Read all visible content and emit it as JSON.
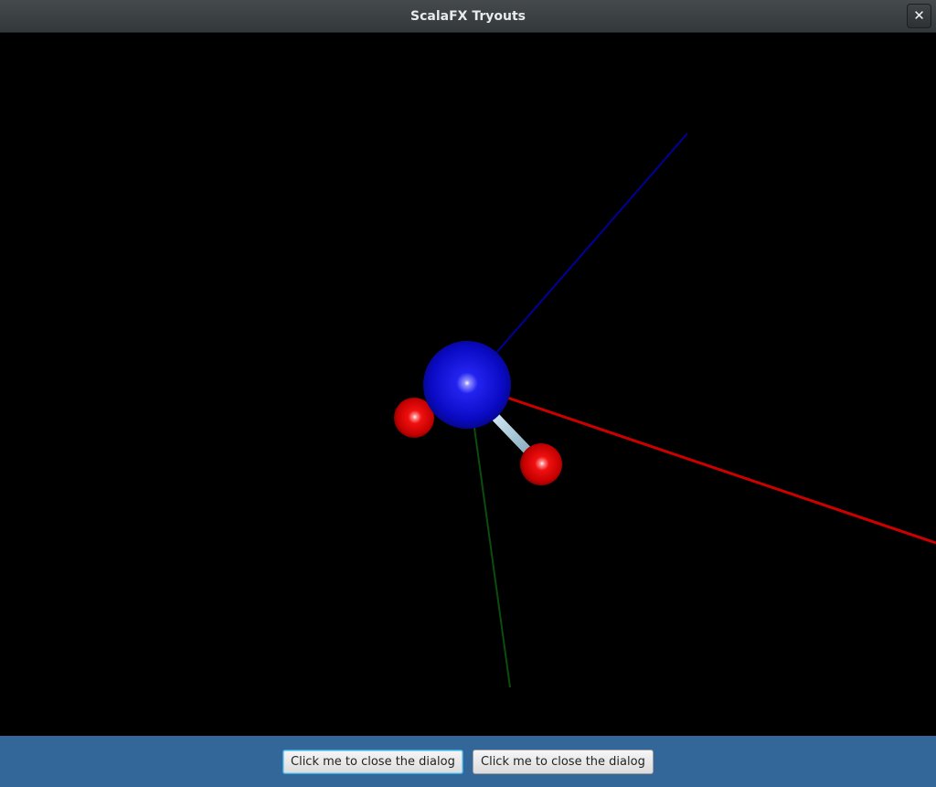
{
  "window": {
    "title": "ScalaFX Tryouts",
    "close_label": "✕"
  },
  "scene": {
    "background": "#000000",
    "atoms": [
      {
        "name": "central-atom",
        "color": "#1515d8"
      },
      {
        "name": "side-atom-left",
        "color": "#e00000"
      },
      {
        "name": "side-atom-right",
        "color": "#e00000"
      }
    ],
    "bond_color": "#a7c7d8",
    "axes": [
      {
        "name": "x-axis",
        "color": "#cc0000"
      },
      {
        "name": "y-axis",
        "color": "#0b4d0b"
      },
      {
        "name": "z-axis",
        "color": "#000099"
      }
    ]
  },
  "buttons": {
    "close_1": "Click me to close the dialog",
    "close_2": "Click me to close the dialog"
  },
  "colors": {
    "button_bar": "#336699",
    "titlebar": "#3a3f41"
  }
}
